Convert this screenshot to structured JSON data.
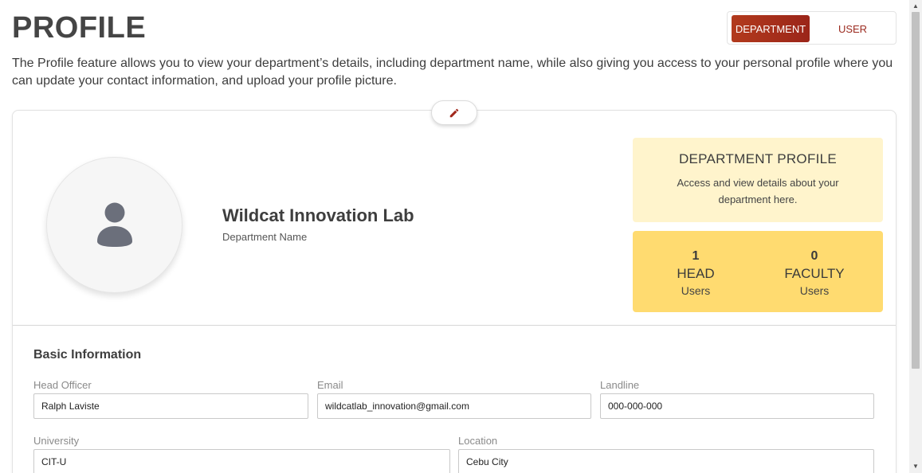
{
  "header": {
    "title": "PROFILE",
    "description": "The Profile feature allows you to view your department’s details, including department name, while also giving you access to your personal profile where you can update your contact information, and upload your profile picture."
  },
  "toggle": {
    "department_label": "DEPARTMENT",
    "user_label": "USER",
    "active": "DEPARTMENT"
  },
  "department": {
    "name": "Wildcat Innovation Lab",
    "name_caption": "Department Name"
  },
  "profile_panel": {
    "heading": "DEPARTMENT PROFILE",
    "text": "Access and view details about your department here."
  },
  "stats": [
    {
      "count": "1",
      "role": "HEAD",
      "unit": "Users"
    },
    {
      "count": "0",
      "role": "FACULTY",
      "unit": "Users"
    }
  ],
  "basic_info": {
    "title": "Basic Information",
    "fields": {
      "head_officer": {
        "label": "Head Officer",
        "value": "Ralph Laviste"
      },
      "email": {
        "label": "Email",
        "value": "wildcatlab_innovation@gmail.com"
      },
      "landline": {
        "label": "Landline",
        "value": "000-000-000"
      },
      "university": {
        "label": "University",
        "value": "CIT-U"
      },
      "location": {
        "label": "Location",
        "value": "Cebu City"
      }
    }
  },
  "colors": {
    "accent": "#9b2519",
    "profile_panel_bg": "#fff4cc",
    "stats_panel_bg": "#ffdb70"
  },
  "icons": {
    "edit": "pencil-icon",
    "avatar": "user-icon"
  }
}
